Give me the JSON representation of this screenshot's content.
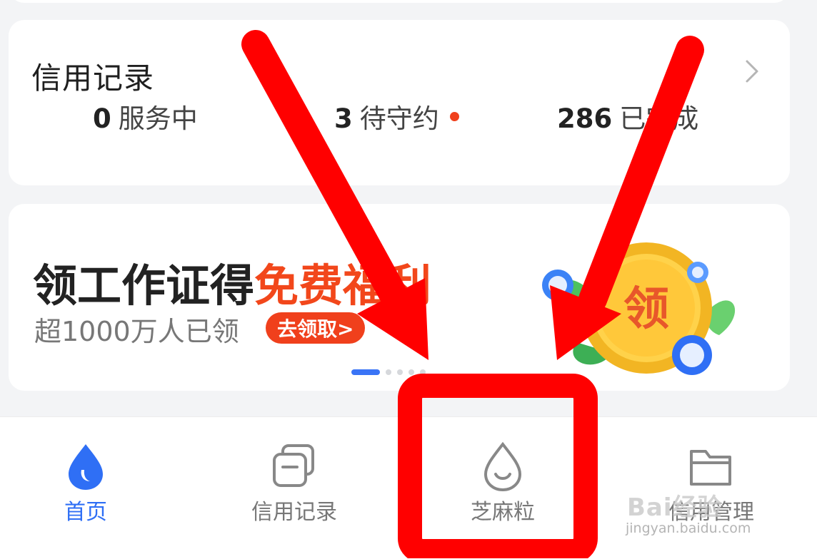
{
  "credit": {
    "title": "信用记录",
    "stats": [
      {
        "num": "0",
        "label": "服务中"
      },
      {
        "num": "3",
        "label": "待守约"
      },
      {
        "num": "286",
        "label": "已完成"
      }
    ]
  },
  "banner": {
    "title_main": "领工作证得",
    "title_highlight": "免费福利",
    "subtitle": "超1000万人已领",
    "cta": "去领取>",
    "coin_text": "领",
    "active_page": 1,
    "page_count": 5
  },
  "tabs": [
    {
      "label": "首页",
      "icon": "drop-filled-icon",
      "active": true
    },
    {
      "label": "信用记录",
      "icon": "cards-icon",
      "active": false
    },
    {
      "label": "芝麻粒",
      "icon": "drop-outline-icon",
      "active": false
    },
    {
      "label": "信用管理",
      "icon": "folder-icon",
      "active": false
    }
  ],
  "watermark": {
    "brand": "Bai经验",
    "url": "jingyan.baidu.com"
  },
  "colors": {
    "accent": "#2f6ff5",
    "highlight": "#f2471b",
    "annotation": "#ff0000"
  }
}
